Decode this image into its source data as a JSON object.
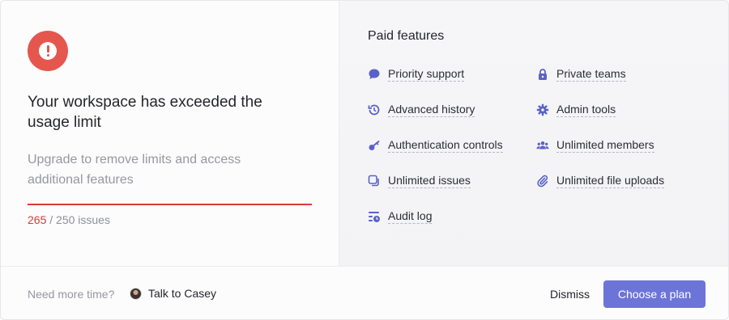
{
  "alert": {
    "title": "Your workspace has exceeded the usage limit",
    "subtitle": "Upgrade to remove limits and access additional features",
    "usage_current": "265",
    "usage_rest": " / 250 issues",
    "usage_fraction": 1.0
  },
  "paid": {
    "title": "Paid features",
    "features": [
      {
        "label": "Priority support",
        "icon": "chat-bubble-icon"
      },
      {
        "label": "Private teams",
        "icon": "lock-icon"
      },
      {
        "label": "Advanced history",
        "icon": "history-icon"
      },
      {
        "label": "Admin tools",
        "icon": "gear-icon"
      },
      {
        "label": "Authentication controls",
        "icon": "key-icon"
      },
      {
        "label": "Unlimited members",
        "icon": "members-icon"
      },
      {
        "label": "Unlimited issues",
        "icon": "issues-icon"
      },
      {
        "label": "Unlimited file uploads",
        "icon": "paperclip-icon"
      },
      {
        "label": "Audit log",
        "icon": "audit-log-icon"
      }
    ]
  },
  "footer": {
    "need_more_time": "Need more time?",
    "talk_label": "Talk to Casey",
    "dismiss_label": "Dismiss",
    "choose_label": "Choose a plan"
  },
  "colors": {
    "alert_red": "#e5564f",
    "progress_red": "#d83a36",
    "accent": "#6d74d8"
  }
}
